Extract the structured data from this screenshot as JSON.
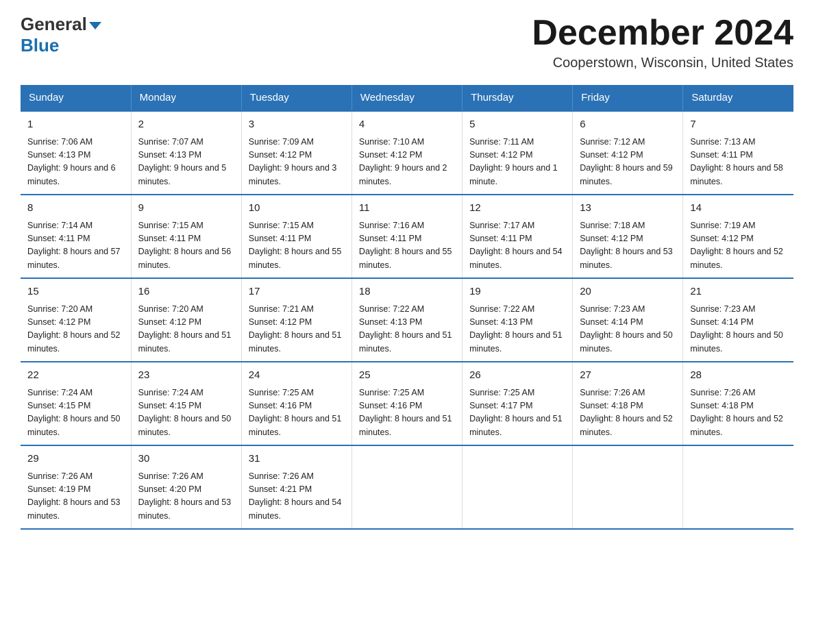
{
  "logo": {
    "line1": "General",
    "arrow": "▶",
    "line2": "Blue"
  },
  "title": "December 2024",
  "location": "Cooperstown, Wisconsin, United States",
  "days_of_week": [
    "Sunday",
    "Monday",
    "Tuesday",
    "Wednesday",
    "Thursday",
    "Friday",
    "Saturday"
  ],
  "weeks": [
    [
      {
        "day": "1",
        "sunrise": "7:06 AM",
        "sunset": "4:13 PM",
        "daylight": "9 hours and 6 minutes."
      },
      {
        "day": "2",
        "sunrise": "7:07 AM",
        "sunset": "4:13 PM",
        "daylight": "9 hours and 5 minutes."
      },
      {
        "day": "3",
        "sunrise": "7:09 AM",
        "sunset": "4:12 PM",
        "daylight": "9 hours and 3 minutes."
      },
      {
        "day": "4",
        "sunrise": "7:10 AM",
        "sunset": "4:12 PM",
        "daylight": "9 hours and 2 minutes."
      },
      {
        "day": "5",
        "sunrise": "7:11 AM",
        "sunset": "4:12 PM",
        "daylight": "9 hours and 1 minute."
      },
      {
        "day": "6",
        "sunrise": "7:12 AM",
        "sunset": "4:12 PM",
        "daylight": "8 hours and 59 minutes."
      },
      {
        "day": "7",
        "sunrise": "7:13 AM",
        "sunset": "4:11 PM",
        "daylight": "8 hours and 58 minutes."
      }
    ],
    [
      {
        "day": "8",
        "sunrise": "7:14 AM",
        "sunset": "4:11 PM",
        "daylight": "8 hours and 57 minutes."
      },
      {
        "day": "9",
        "sunrise": "7:15 AM",
        "sunset": "4:11 PM",
        "daylight": "8 hours and 56 minutes."
      },
      {
        "day": "10",
        "sunrise": "7:15 AM",
        "sunset": "4:11 PM",
        "daylight": "8 hours and 55 minutes."
      },
      {
        "day": "11",
        "sunrise": "7:16 AM",
        "sunset": "4:11 PM",
        "daylight": "8 hours and 55 minutes."
      },
      {
        "day": "12",
        "sunrise": "7:17 AM",
        "sunset": "4:11 PM",
        "daylight": "8 hours and 54 minutes."
      },
      {
        "day": "13",
        "sunrise": "7:18 AM",
        "sunset": "4:12 PM",
        "daylight": "8 hours and 53 minutes."
      },
      {
        "day": "14",
        "sunrise": "7:19 AM",
        "sunset": "4:12 PM",
        "daylight": "8 hours and 52 minutes."
      }
    ],
    [
      {
        "day": "15",
        "sunrise": "7:20 AM",
        "sunset": "4:12 PM",
        "daylight": "8 hours and 52 minutes."
      },
      {
        "day": "16",
        "sunrise": "7:20 AM",
        "sunset": "4:12 PM",
        "daylight": "8 hours and 51 minutes."
      },
      {
        "day": "17",
        "sunrise": "7:21 AM",
        "sunset": "4:12 PM",
        "daylight": "8 hours and 51 minutes."
      },
      {
        "day": "18",
        "sunrise": "7:22 AM",
        "sunset": "4:13 PM",
        "daylight": "8 hours and 51 minutes."
      },
      {
        "day": "19",
        "sunrise": "7:22 AM",
        "sunset": "4:13 PM",
        "daylight": "8 hours and 51 minutes."
      },
      {
        "day": "20",
        "sunrise": "7:23 AM",
        "sunset": "4:14 PM",
        "daylight": "8 hours and 50 minutes."
      },
      {
        "day": "21",
        "sunrise": "7:23 AM",
        "sunset": "4:14 PM",
        "daylight": "8 hours and 50 minutes."
      }
    ],
    [
      {
        "day": "22",
        "sunrise": "7:24 AM",
        "sunset": "4:15 PM",
        "daylight": "8 hours and 50 minutes."
      },
      {
        "day": "23",
        "sunrise": "7:24 AM",
        "sunset": "4:15 PM",
        "daylight": "8 hours and 50 minutes."
      },
      {
        "day": "24",
        "sunrise": "7:25 AM",
        "sunset": "4:16 PM",
        "daylight": "8 hours and 51 minutes."
      },
      {
        "day": "25",
        "sunrise": "7:25 AM",
        "sunset": "4:16 PM",
        "daylight": "8 hours and 51 minutes."
      },
      {
        "day": "26",
        "sunrise": "7:25 AM",
        "sunset": "4:17 PM",
        "daylight": "8 hours and 51 minutes."
      },
      {
        "day": "27",
        "sunrise": "7:26 AM",
        "sunset": "4:18 PM",
        "daylight": "8 hours and 52 minutes."
      },
      {
        "day": "28",
        "sunrise": "7:26 AM",
        "sunset": "4:18 PM",
        "daylight": "8 hours and 52 minutes."
      }
    ],
    [
      {
        "day": "29",
        "sunrise": "7:26 AM",
        "sunset": "4:19 PM",
        "daylight": "8 hours and 53 minutes."
      },
      {
        "day": "30",
        "sunrise": "7:26 AM",
        "sunset": "4:20 PM",
        "daylight": "8 hours and 53 minutes."
      },
      {
        "day": "31",
        "sunrise": "7:26 AM",
        "sunset": "4:21 PM",
        "daylight": "8 hours and 54 minutes."
      },
      {
        "day": "",
        "sunrise": "",
        "sunset": "",
        "daylight": ""
      },
      {
        "day": "",
        "sunrise": "",
        "sunset": "",
        "daylight": ""
      },
      {
        "day": "",
        "sunrise": "",
        "sunset": "",
        "daylight": ""
      },
      {
        "day": "",
        "sunrise": "",
        "sunset": "",
        "daylight": ""
      }
    ]
  ],
  "labels": {
    "sunrise_prefix": "Sunrise: ",
    "sunset_prefix": "Sunset: ",
    "daylight_prefix": "Daylight: "
  }
}
